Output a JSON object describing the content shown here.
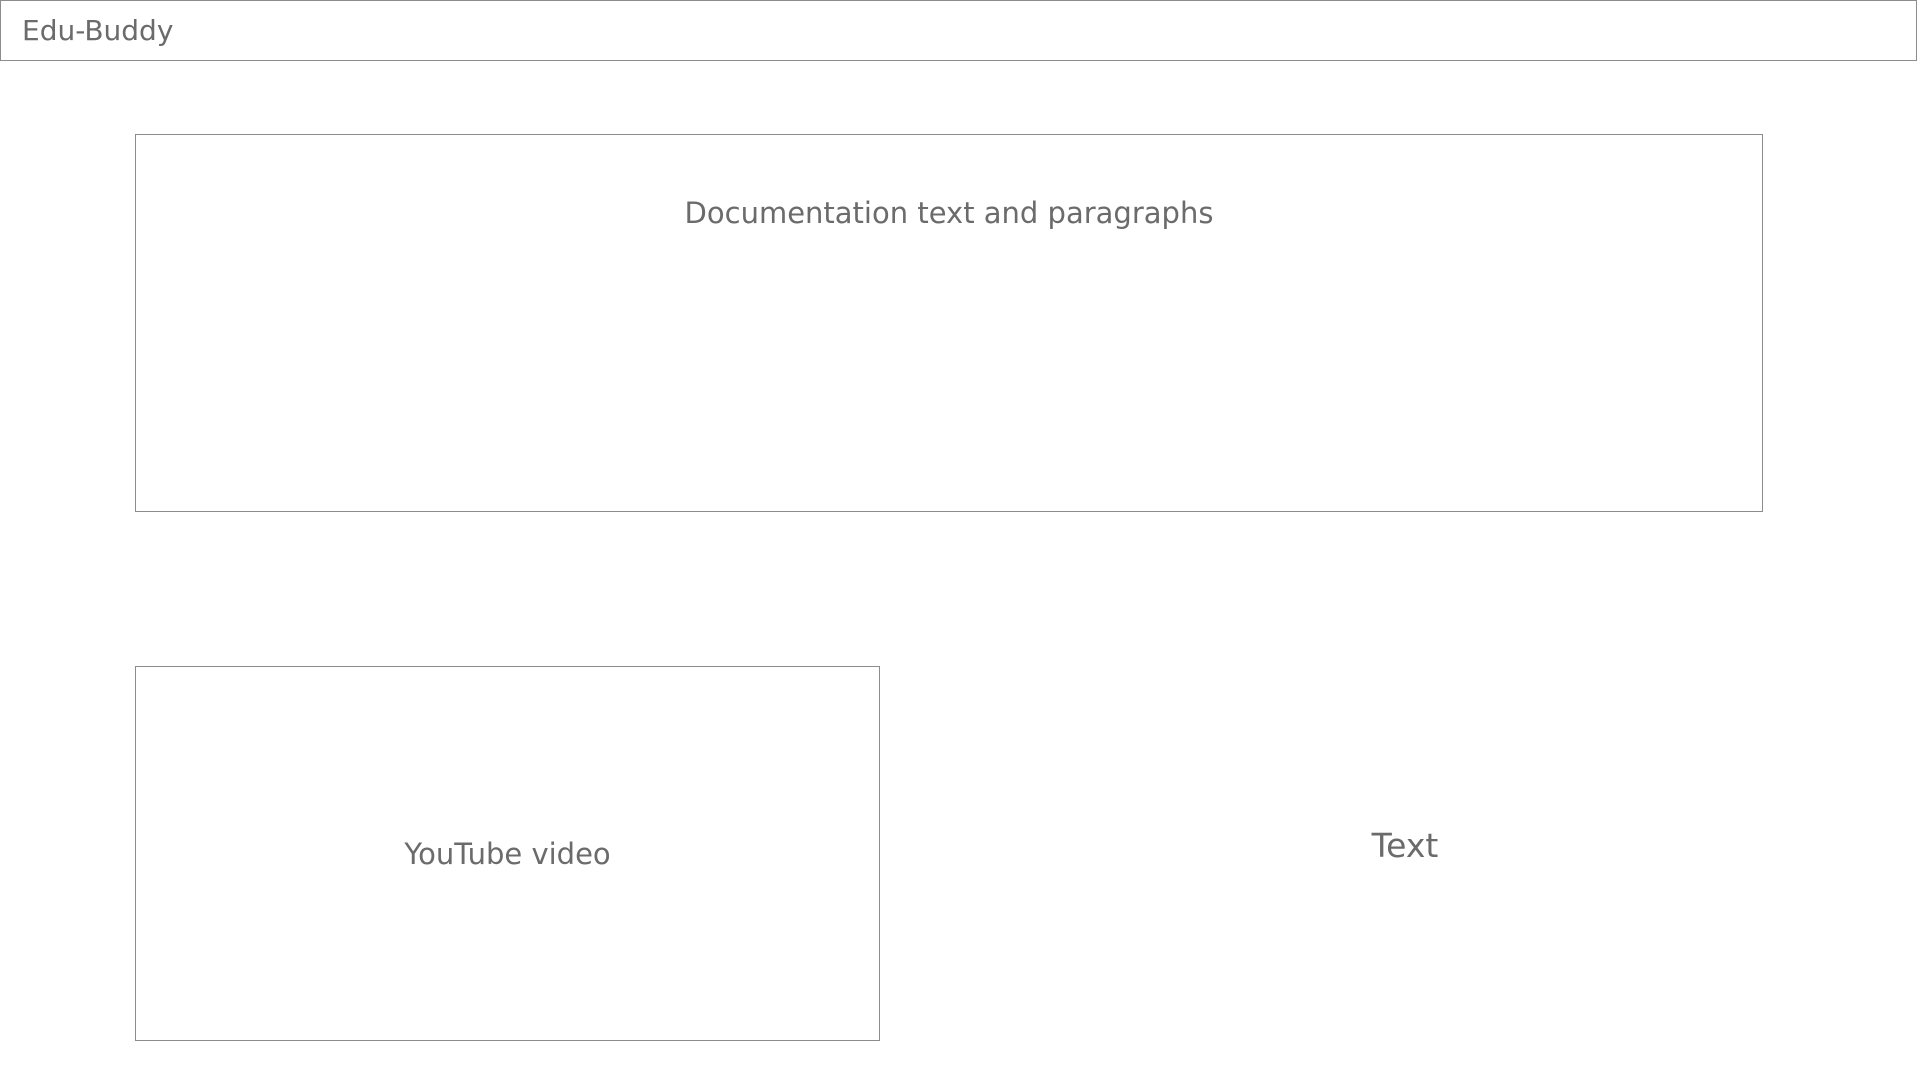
{
  "header": {
    "title": "Edu-Buddy"
  },
  "documentation": {
    "label": "Documentation text and paragraphs"
  },
  "video": {
    "label": "YouTube video"
  },
  "side": {
    "text": "Text"
  },
  "colors": {
    "border": "#8c8c8c",
    "text": "#6b6b6b",
    "background": "#ffffff"
  }
}
